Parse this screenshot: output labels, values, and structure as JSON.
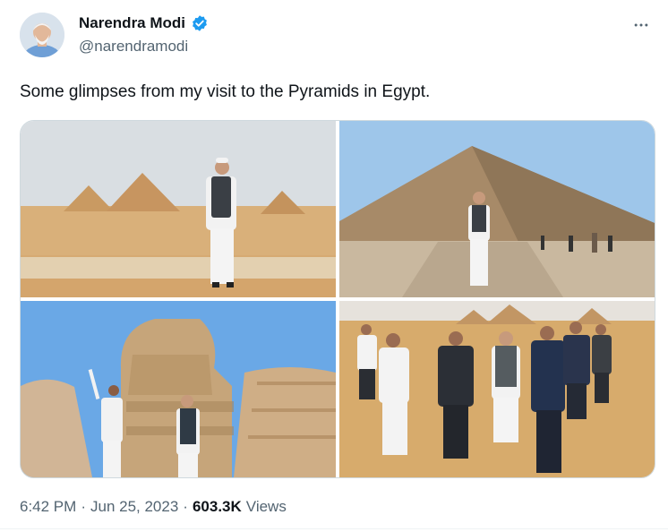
{
  "author": {
    "display_name": "Narendra Modi",
    "handle": "@narendramodi"
  },
  "tweet": {
    "text": "Some glimpses from my visit to the Pyramids in Egypt."
  },
  "meta": {
    "time": "6:42 PM",
    "sep1": "·",
    "date": "Jun 25, 2023",
    "sep2": "·",
    "views_count": "603.3K",
    "views_label": "Views"
  },
  "colors": {
    "verified_blue": "#1d9bf0",
    "text_primary": "#0f1419",
    "text_secondary": "#536471",
    "border": "#cfd9de"
  },
  "icons": {
    "verified": "verified-badge-icon",
    "more": "more-options-icon"
  }
}
